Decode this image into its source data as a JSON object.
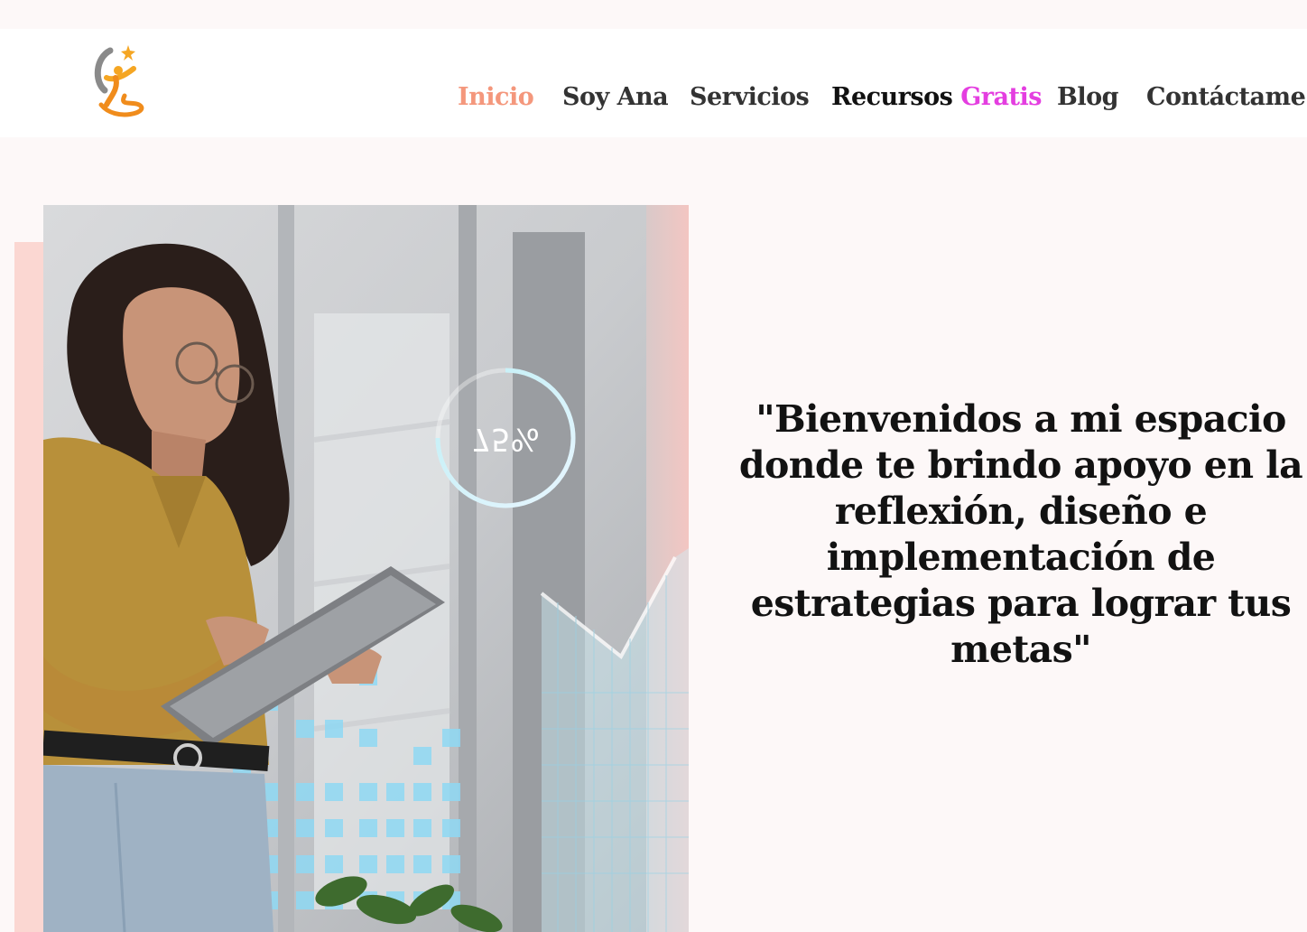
{
  "nav": {
    "items": [
      {
        "label": "Inicio",
        "active": true
      },
      {
        "label": "Soy Ana"
      },
      {
        "label": "Servicios"
      },
      {
        "label": "Recursos",
        "accent": "Gratis"
      },
      {
        "label": "Blog"
      },
      {
        "label": "Contáctame"
      }
    ]
  },
  "hero": {
    "quote": "\"Bienvenidos a mi espacio donde te brindo apoyo en la reflexión, diseño e implementación de estrategias para lograr tus metas\"",
    "overlay_percent": "75%"
  },
  "colors": {
    "active_nav": "#f4977c",
    "accent_nav": "#e43ee0",
    "page_bg": "#fdf8f8",
    "pink_block": "#fbd7d2"
  },
  "icons": [
    "logo-icon",
    "progress-ring-icon"
  ]
}
